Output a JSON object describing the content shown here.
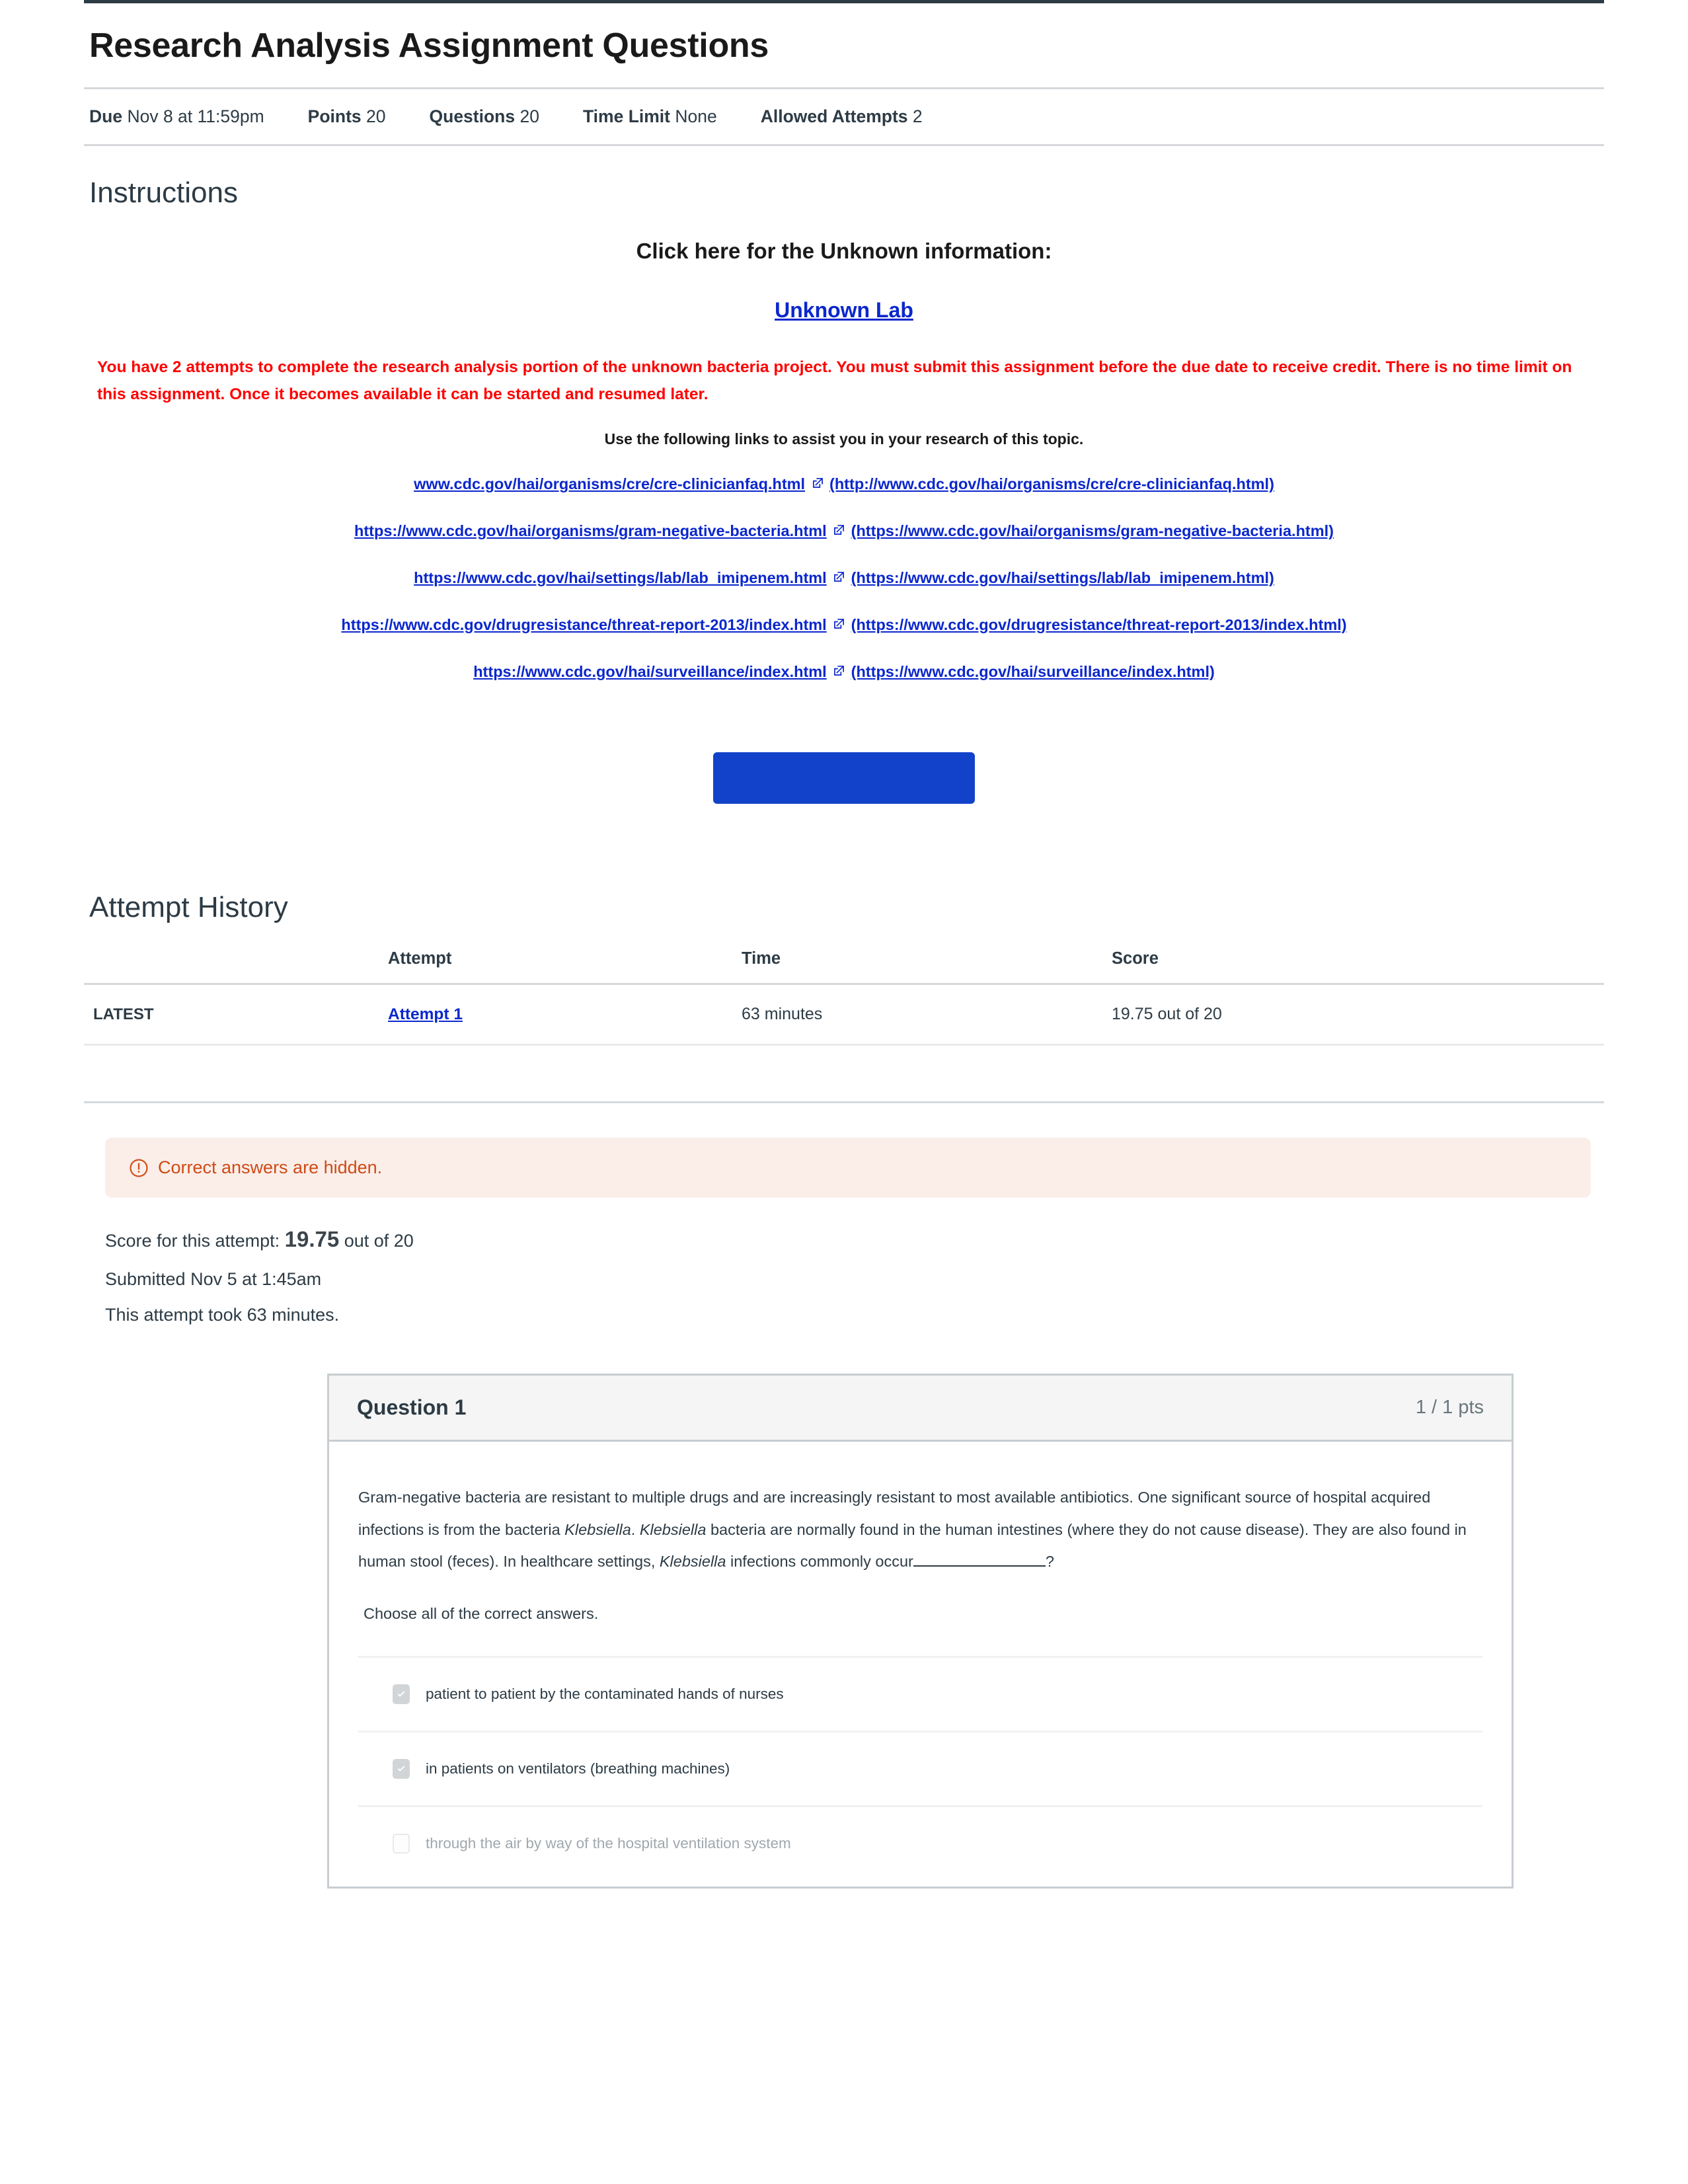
{
  "header": {
    "title": "Research Analysis Assignment Questions",
    "meta": [
      {
        "label": "Due",
        "value": "Nov 8 at 11:59pm"
      },
      {
        "label": "Points",
        "value": "20"
      },
      {
        "label": "Questions",
        "value": "20"
      },
      {
        "label": "Time Limit",
        "value": "None"
      },
      {
        "label": "Allowed Attempts",
        "value": "2"
      }
    ]
  },
  "instructions": {
    "heading": "Instructions",
    "click_here": "Click here for the Unknown information:",
    "unknown_lab_link": "Unknown Lab",
    "warning": "You have 2 attempts to complete the research analysis portion of the unknown bacteria project. You must submit this assignment before the due date to receive credit. There is no time limit on this assignment. Once it becomes available it can be started and resumed later.",
    "use_links": "Use the following links to assist you in your research of this topic.",
    "links": [
      {
        "text": "www.cdc.gov/hai/organisms/cre/cre-clinicianfaq.html",
        "paren": "(http://www.cdc.gov/hai/organisms/cre/cre-clinicianfaq.html)"
      },
      {
        "text": "https://www.cdc.gov/hai/organisms/gram-negative-bacteria.html",
        "paren": "(https://www.cdc.gov/hai/organisms/gram-negative-bacteria.html)"
      },
      {
        "text": "https://www.cdc.gov/hai/settings/lab/lab_imipenem.html",
        "paren": "(https://www.cdc.gov/hai/settings/lab/lab_imipenem.html)"
      },
      {
        "text": "https://www.cdc.gov/drugresistance/threat-report-2013/index.html",
        "paren": "(https://www.cdc.gov/drugresistance/threat-report-2013/index.html)"
      },
      {
        "text": "https://www.cdc.gov/hai/surveillance/index.html",
        "paren": "(https://www.cdc.gov/hai/surveillance/index.html)"
      }
    ],
    "take_quiz_button_label": "",
    "take_quiz_button_color": "#1342ca"
  },
  "attempt_history": {
    "heading": "Attempt History",
    "columns": [
      "",
      "Attempt",
      "Time",
      "Score"
    ],
    "rows": [
      {
        "marker": "LATEST",
        "attempt": "Attempt 1 ",
        "time": "63 minutes",
        "score": "19.75 out of 20"
      }
    ]
  },
  "result": {
    "alert_icon": "warning-circle-icon",
    "alert_text": "Correct answers are hidden.",
    "alert_bg": "#fbeee9",
    "alert_color": "#cf4a16",
    "score_label": "Score for this attempt:",
    "score_value": "19.75",
    "score_suffix": "out of 20",
    "submitted": "Submitted Nov 5 at 1:45am",
    "took": "This attempt took 63 minutes."
  },
  "question": {
    "title": "Question 1",
    "points": "1 / 1 pts",
    "text_part_1": "Gram-negative bacteria are resistant to multiple drugs and are increasingly resistant to most available antibiotics. One significant source of hospital acquired infections is from the bacteria ",
    "italic_1": "Klebsiella",
    "text_part_2": ". ",
    "italic_2": "Klebsiella",
    "text_part_3": " bacteria are normally found in the human intestines (where they do not cause disease). They are also found in human stool (feces).  In healthcare settings, ",
    "italic_3": "Klebsiella",
    "text_part_4": " infections commonly occur",
    "text_part_5": "?",
    "choose_all": "Choose all of the correct answers.",
    "answers": [
      {
        "label": "patient to patient by the contaminated hands of nurses",
        "checked": true
      },
      {
        "label": "in patients on ventilators (breathing machines)",
        "checked": true
      },
      {
        "label": "through the air by way of the hospital ventilation system",
        "checked": false
      }
    ]
  }
}
